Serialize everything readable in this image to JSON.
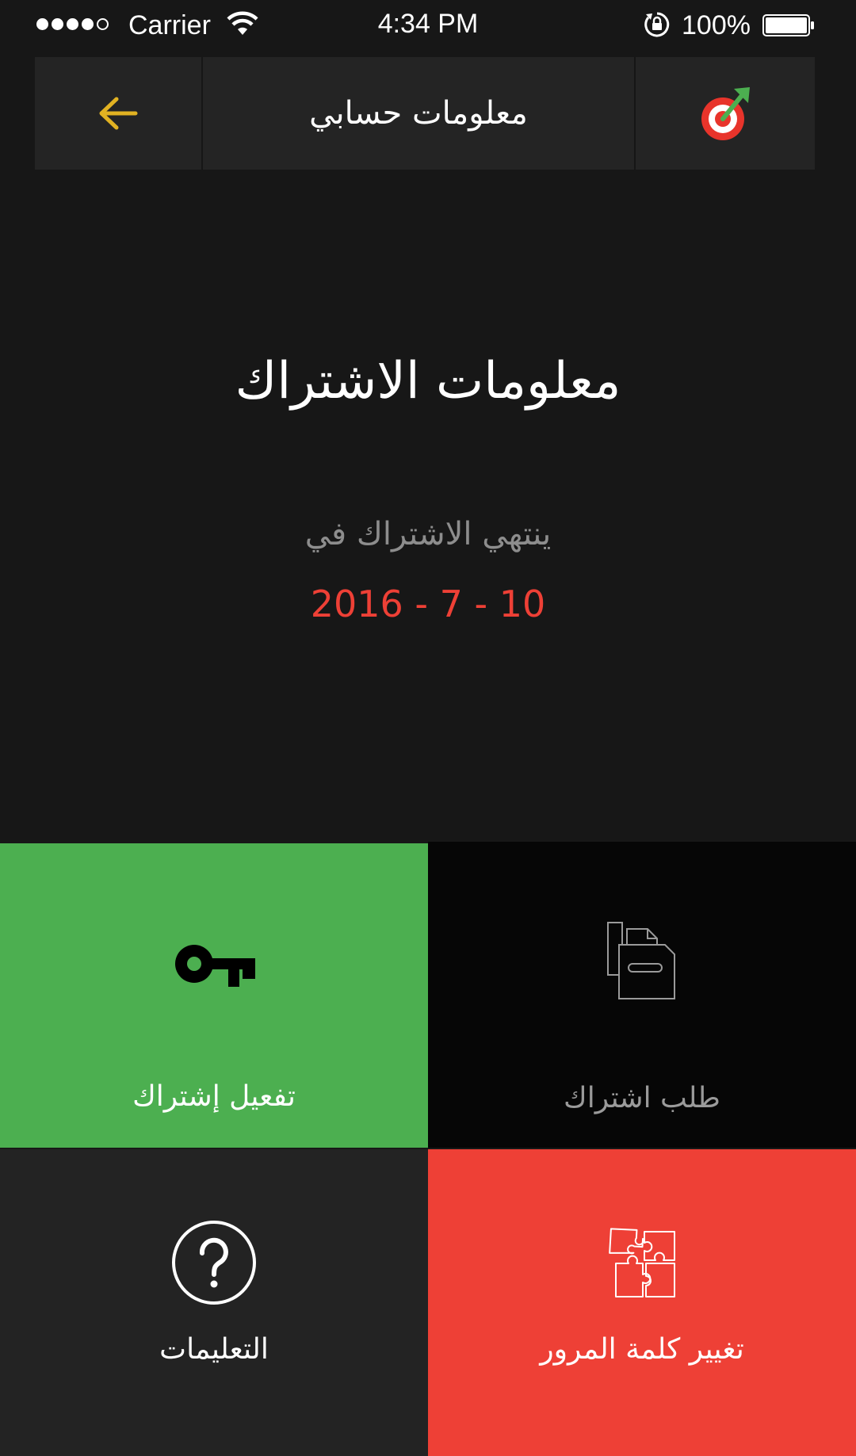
{
  "status_bar": {
    "carrier": "Carrier",
    "time": "4:34 PM",
    "battery": "100%",
    "signal_bars": 4,
    "signal_total": 5
  },
  "header": {
    "title": "معلومات حسابي",
    "back_icon": "arrow-left-icon",
    "logo_icon": "target-arrow-logo-icon",
    "back_color": "#e1b222"
  },
  "main": {
    "heading": "معلومات الاشتراك",
    "expire_label": "ينتهي الاشتراك في",
    "expire_date": "2016 - 7 - 10"
  },
  "tiles": [
    {
      "label": "تفعيل إشتراك",
      "icon": "key-icon",
      "color": "#4caf50"
    },
    {
      "label": "طلب اشتراك",
      "icon": "documents-icon",
      "color": "#060606"
    },
    {
      "label": "التعليمات",
      "icon": "help-circle-icon",
      "color": "#232323"
    },
    {
      "label": "تغيير كلمة المرور",
      "icon": "puzzle-icon",
      "color": "#ee4036"
    }
  ],
  "colors": {
    "background": "#171717",
    "accent_red": "#ee4036",
    "accent_green": "#4caf50",
    "accent_yellow": "#e1b222"
  }
}
